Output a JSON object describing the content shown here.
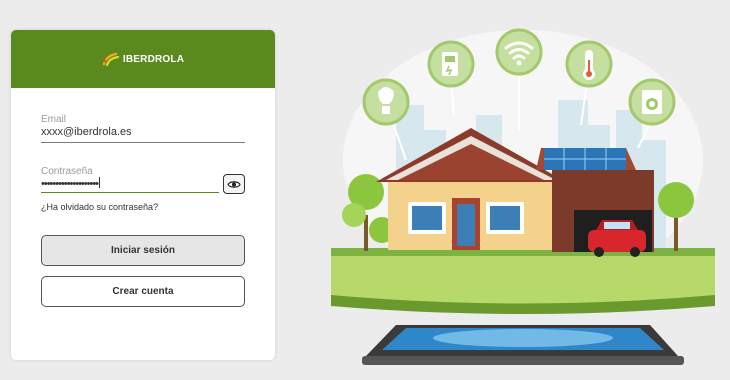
{
  "brand": {
    "name": "IBERDROLA",
    "color": "#5a8a1e"
  },
  "login": {
    "email_label": "Email",
    "email_value": "xxxx@iberdrola.es",
    "password_label": "Contraseña",
    "password_value": "••••••••••••••••••••",
    "forgot_link": "¿Ha olvidado su contraseña?",
    "login_button": "Iniciar sesión",
    "create_button": "Crear cuenta"
  },
  "icons": {
    "show_password": "eye-icon",
    "smart_devices": [
      "light-bulb-icon",
      "ev-charger-icon",
      "wifi-icon",
      "thermometer-icon",
      "washing-machine-icon"
    ]
  }
}
